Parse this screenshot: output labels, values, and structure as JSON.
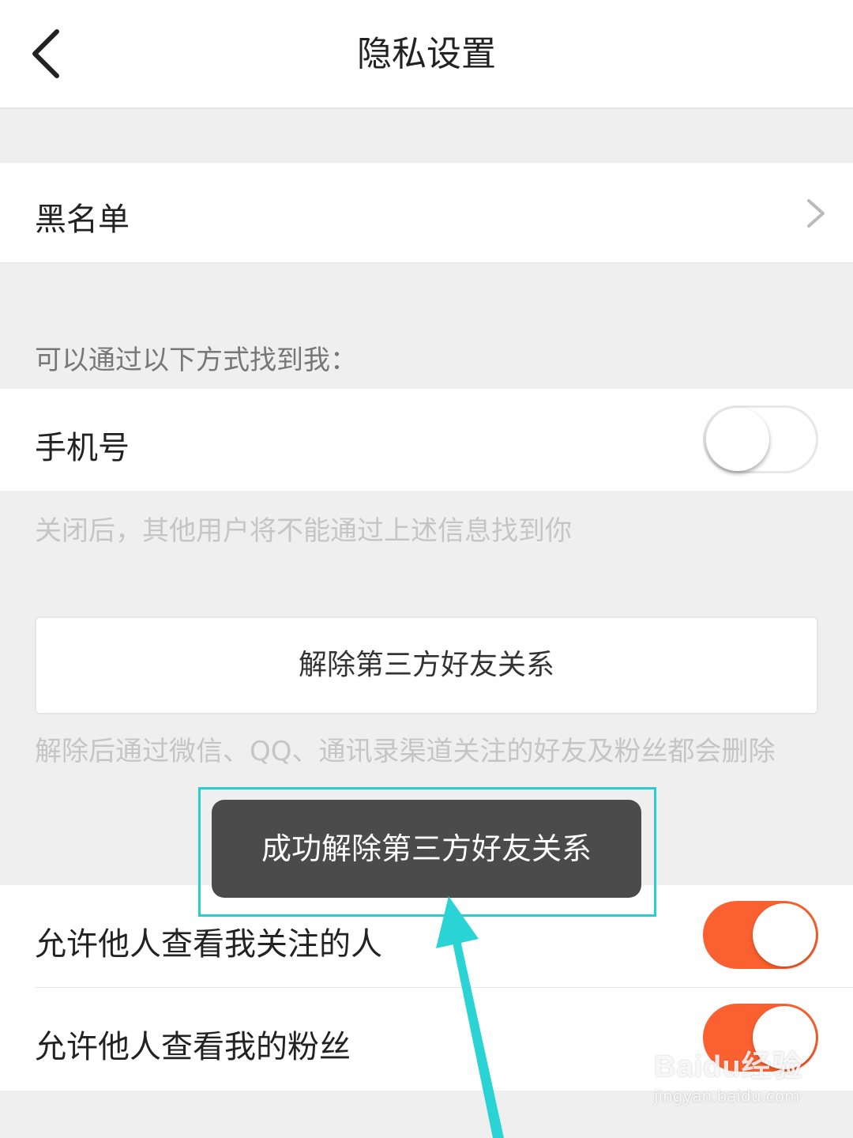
{
  "header": {
    "title": "隐私设置"
  },
  "blacklist": {
    "label": "黑名单"
  },
  "find_me": {
    "section_label": "可以通过以下方式找到我：",
    "phone": {
      "label": "手机号",
      "enabled": false
    },
    "hint": "关闭后，其他用户将不能通过上述信息找到你"
  },
  "third_party": {
    "button_label": "解除第三方好友关系",
    "hint": "解除后通过微信、QQ、通讯录渠道关注的好友及粉丝都会删除"
  },
  "visibility": {
    "follows": {
      "label": "允许他人查看我关注的人",
      "enabled": true
    },
    "fans": {
      "label": "允许他人查看我的粉丝",
      "enabled": true
    }
  },
  "toast": {
    "message": "成功解除第三方好友关系"
  },
  "watermark": {
    "logo": "Baidu经验",
    "url": "jingyan.baidu.com"
  },
  "colors": {
    "accent": "#fb6130",
    "highlight": "#27cfd1",
    "toast_bg": "#4b4b4b"
  }
}
